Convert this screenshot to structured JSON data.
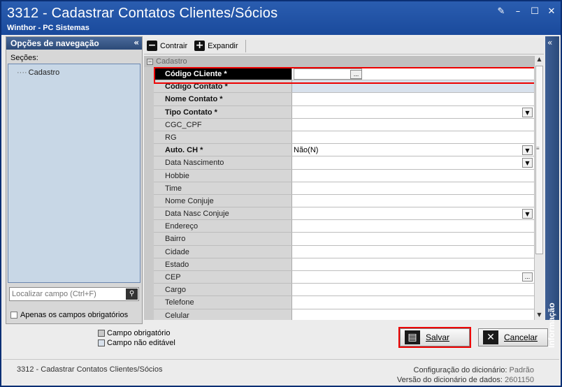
{
  "window": {
    "title": "3312 - Cadastrar Contatos Clientes/Sócios",
    "subtitle": "Winthor - PC Sistemas"
  },
  "nav": {
    "header": "Opções de navegação",
    "sections_label": "Seções:",
    "tree_items": [
      "Cadastro"
    ],
    "find_placeholder": "Localizar campo (Ctrl+F)",
    "only_required_label": "Apenas os campos obrigatórios"
  },
  "toolbar": {
    "collapse_label": "Contrair",
    "expand_label": "Expandir"
  },
  "grid": {
    "group_label": "Cadastro",
    "rows": [
      {
        "label": "Código CLiente *",
        "value": "",
        "required": true,
        "control": "lookup",
        "selected": true
      },
      {
        "label": "Código Contato *",
        "value": "",
        "required": true,
        "control": "readonly"
      },
      {
        "label": "Nome Contato *",
        "value": "",
        "required": true,
        "control": "text"
      },
      {
        "label": "Tipo Contato *",
        "value": "",
        "required": true,
        "control": "dropdown"
      },
      {
        "label": "CGC_CPF",
        "value": "",
        "required": false,
        "control": "text"
      },
      {
        "label": "RG",
        "value": "",
        "required": false,
        "control": "text"
      },
      {
        "label": "Auto. CH *",
        "value": "Não(N)",
        "required": true,
        "control": "dropdown"
      },
      {
        "label": "Data Nascimento",
        "value": "",
        "required": false,
        "control": "dropdown"
      },
      {
        "label": "Hobbie",
        "value": "",
        "required": false,
        "control": "text"
      },
      {
        "label": "Time",
        "value": "",
        "required": false,
        "control": "text"
      },
      {
        "label": "Nome Conjuje",
        "value": "",
        "required": false,
        "control": "text"
      },
      {
        "label": "Data Nasc Conjuje",
        "value": "",
        "required": false,
        "control": "dropdown"
      },
      {
        "label": "Endereço",
        "value": "",
        "required": false,
        "control": "text"
      },
      {
        "label": "Bairro",
        "value": "",
        "required": false,
        "control": "text"
      },
      {
        "label": "Cidade",
        "value": "",
        "required": false,
        "control": "text"
      },
      {
        "label": "Estado",
        "value": "",
        "required": false,
        "control": "text"
      },
      {
        "label": "CEP",
        "value": "",
        "required": false,
        "control": "ellipsis"
      },
      {
        "label": "Cargo",
        "value": "",
        "required": false,
        "control": "text"
      },
      {
        "label": "Telefone",
        "value": "",
        "required": false,
        "control": "text"
      },
      {
        "label": "Celular",
        "value": "",
        "required": false,
        "control": "text"
      }
    ]
  },
  "info_panel": {
    "label": "Informação"
  },
  "legend": {
    "required_label": "Campo obrigatório",
    "readonly_label": "Campo não editável"
  },
  "actions": {
    "save_label": "Salvar",
    "cancel_label": "Cancelar"
  },
  "status": {
    "left": "3312 - Cadastrar Contatos Clientes/Sócios",
    "dict_config_label": "Configuração do dicionário:",
    "dict_config_value": "Padrão",
    "dict_version_label": "Versão do dicionário de dados:",
    "dict_version_value": "2601150"
  },
  "icons": {
    "minimize": "minimize-icon",
    "restore": "restore-icon",
    "maximize": "maximize-icon",
    "close": "close-icon"
  },
  "colors": {
    "titlebar": "#1a4a9c",
    "highlight": "#e00000",
    "readonly_field": "#d8e1ec",
    "sections_bg": "#c8d7e6"
  }
}
